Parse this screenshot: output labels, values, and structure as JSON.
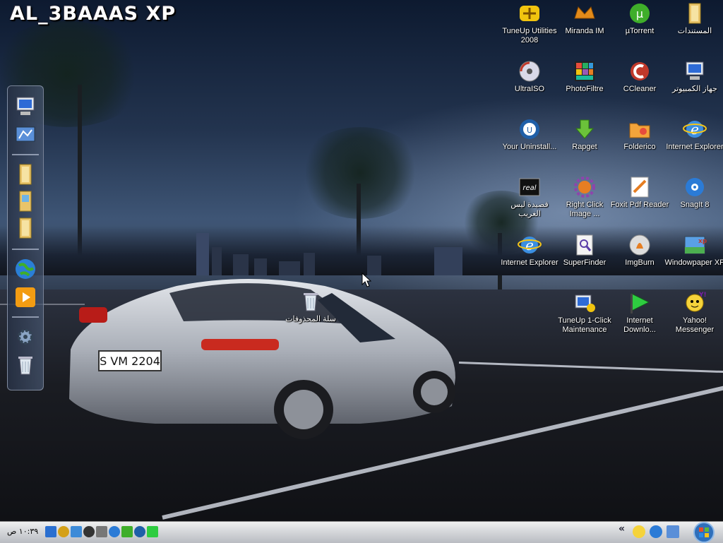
{
  "brand": "AL_3BAAAS XP",
  "desktop_icons": [
    {
      "label": "TuneUp Utilities 2008",
      "icon": "tuneup-utilities-icon"
    },
    {
      "label": "Miranda IM",
      "icon": "miranda-im-icon"
    },
    {
      "label": "µTorrent",
      "icon": "utorrent-icon"
    },
    {
      "label": "المستندات",
      "icon": "my-documents-folder-icon"
    },
    {
      "label": "UltraISO",
      "icon": "ultraiso-icon"
    },
    {
      "label": "PhotoFiltre",
      "icon": "photofiltre-icon"
    },
    {
      "label": "CCleaner",
      "icon": "ccleaner-icon"
    },
    {
      "label": "جهاز الكمبيوتر",
      "icon": "my-computer-icon"
    },
    {
      "label": "Your Uninstall...",
      "icon": "your-uninstaller-icon"
    },
    {
      "label": "Rapget",
      "icon": "rapget-icon"
    },
    {
      "label": "Folderico",
      "icon": "folderico-icon"
    },
    {
      "label": "Internet Explorer",
      "icon": "internet-explorer-icon"
    },
    {
      "label": "قصيدة ليس الغريب",
      "icon": "realplayer-file-icon"
    },
    {
      "label": "Right Click Image ...",
      "icon": "right-click-image-icon"
    },
    {
      "label": "Foxit Pdf Reader",
      "icon": "foxit-pdf-icon"
    },
    {
      "label": "SnagIt 8",
      "icon": "snagit-icon"
    },
    {
      "label": "Internet Explorer",
      "icon": "internet-explorer-icon"
    },
    {
      "label": "SuperFinder",
      "icon": "superfinder-icon"
    },
    {
      "label": "ImgBurn",
      "icon": "imgburn-icon"
    },
    {
      "label": "Windowpaper XP",
      "icon": "windowpaper-xp-icon"
    },
    {
      "label": "TuneUp 1-Click Maintenance",
      "icon": "tuneup-maintenance-icon"
    },
    {
      "label": "Internet Downlo...",
      "icon": "internet-download-manager-icon"
    },
    {
      "label": "Yahoo! Messenger",
      "icon": "yahoo-messenger-icon"
    },
    {
      "label": "سلة المحذوفات",
      "icon": "recycle-bin-icon"
    }
  ],
  "dock_items": [
    "my-computer-icon",
    "control-panel-icon",
    "folder-icon",
    "pictures-folder-icon",
    "folder-icon",
    "globe-icon",
    "media-player-icon",
    "settings-gear-icon",
    "recycle-bin-icon"
  ],
  "taskbar": {
    "clock": "١٠:٣٩ ص",
    "quick_launch": [
      "show-desktop-icon",
      "brush-icon",
      "folder-icon",
      "arrow-icon",
      "media-icon",
      "snagit-icon",
      "globe-icon",
      "messenger-icon",
      "play-icon"
    ],
    "tray": [
      "tray-chevron-icon",
      "yahoo-tray-icon",
      "snagit-tray-icon",
      "network-tray-icon"
    ],
    "start_icon": "windows-start-orb-icon"
  }
}
